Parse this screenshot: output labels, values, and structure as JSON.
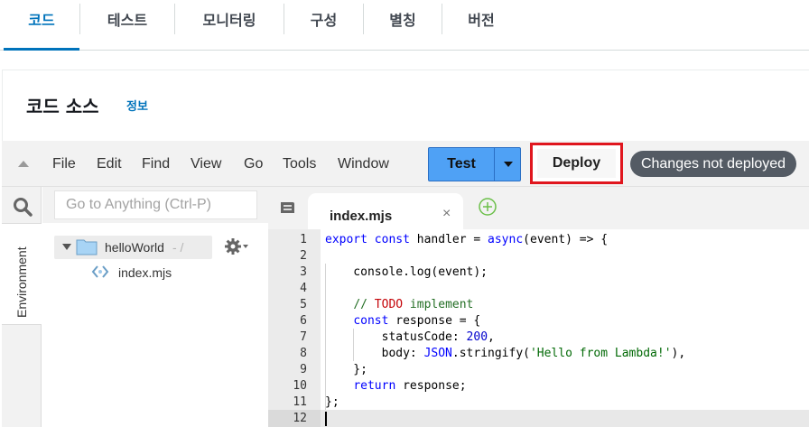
{
  "tabs": [
    {
      "label": "코드",
      "active": true
    },
    {
      "label": "테스트",
      "active": false
    },
    {
      "label": "모니터링",
      "active": false
    },
    {
      "label": "구성",
      "active": false
    },
    {
      "label": "별칭",
      "active": false
    },
    {
      "label": "버전",
      "active": false
    }
  ],
  "code_source": {
    "title": "코드 소스",
    "info_link": "정보"
  },
  "ide": {
    "menu": [
      "File",
      "Edit",
      "Find",
      "View",
      "Go",
      "Tools",
      "Window"
    ],
    "test_label": "Test",
    "deploy_label": "Deploy",
    "status": "Changes not deployed",
    "search_placeholder": "Go to Anything (Ctrl-P)",
    "environment_label": "Environment",
    "folder_name": "helloWorld",
    "folder_path": "- /",
    "file_name": "index.mjs",
    "open_tab": "index.mjs",
    "tab_close": "×",
    "code_lines": [
      "export const handler = async(event) => {",
      "",
      "    console.log(event);",
      "",
      "    // TODO implement",
      "    const response = {",
      "        statusCode: 200,",
      "        body: JSON.stringify('Hello from Lambda!'),",
      "    };",
      "    return response;",
      "};",
      ""
    ]
  },
  "colors": {
    "accent": "#0073bb",
    "test_button": "#4fa1f5",
    "highlight_border": "#e0161e",
    "status_badge": "#545b64"
  },
  "icons": {
    "search": "search-icon",
    "folder": "folder-icon",
    "gear": "gear-icon",
    "file": "code-file-icon",
    "new_tab": "plus-circle-icon",
    "collapse": "chevron-up-icon"
  }
}
